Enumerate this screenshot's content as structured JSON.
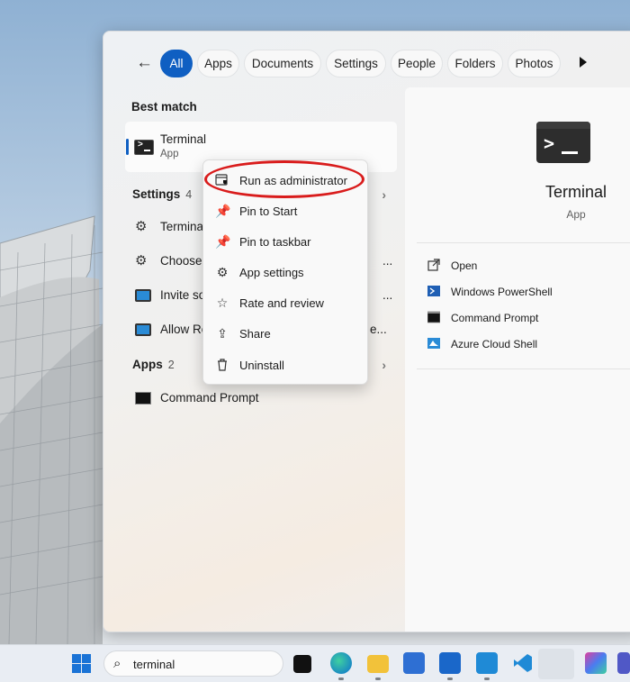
{
  "tabs": {
    "back_label": "←",
    "items": [
      "All",
      "Apps",
      "Documents",
      "Settings",
      "People",
      "Folders",
      "Photos"
    ],
    "active": "All",
    "more_icon": "play-icon"
  },
  "best_match": {
    "title": "Best match",
    "name": "Terminal",
    "type": "App"
  },
  "settings_section": {
    "title": "Settings",
    "count": "4",
    "items": [
      "Terminal",
      "Choose a",
      "Invite so",
      "Allow Re"
    ],
    "truncation": [
      "...",
      "...",
      "e..."
    ]
  },
  "apps_section": {
    "title": "Apps",
    "count": "2",
    "items": [
      "Command Prompt"
    ]
  },
  "context_menu": {
    "items": [
      "Run as administrator",
      "Pin to Start",
      "Pin to taskbar",
      "App settings",
      "Rate and review",
      "Share",
      "Uninstall"
    ]
  },
  "detail": {
    "name": "Terminal",
    "type": "App",
    "actions": [
      "Open",
      "Windows PowerShell",
      "Command Prompt",
      "Azure Cloud Shell"
    ]
  },
  "taskbar": {
    "search_value": "terminal"
  },
  "colors": {
    "accent": "#0f5fc2",
    "annotation": "#d91c1c"
  }
}
